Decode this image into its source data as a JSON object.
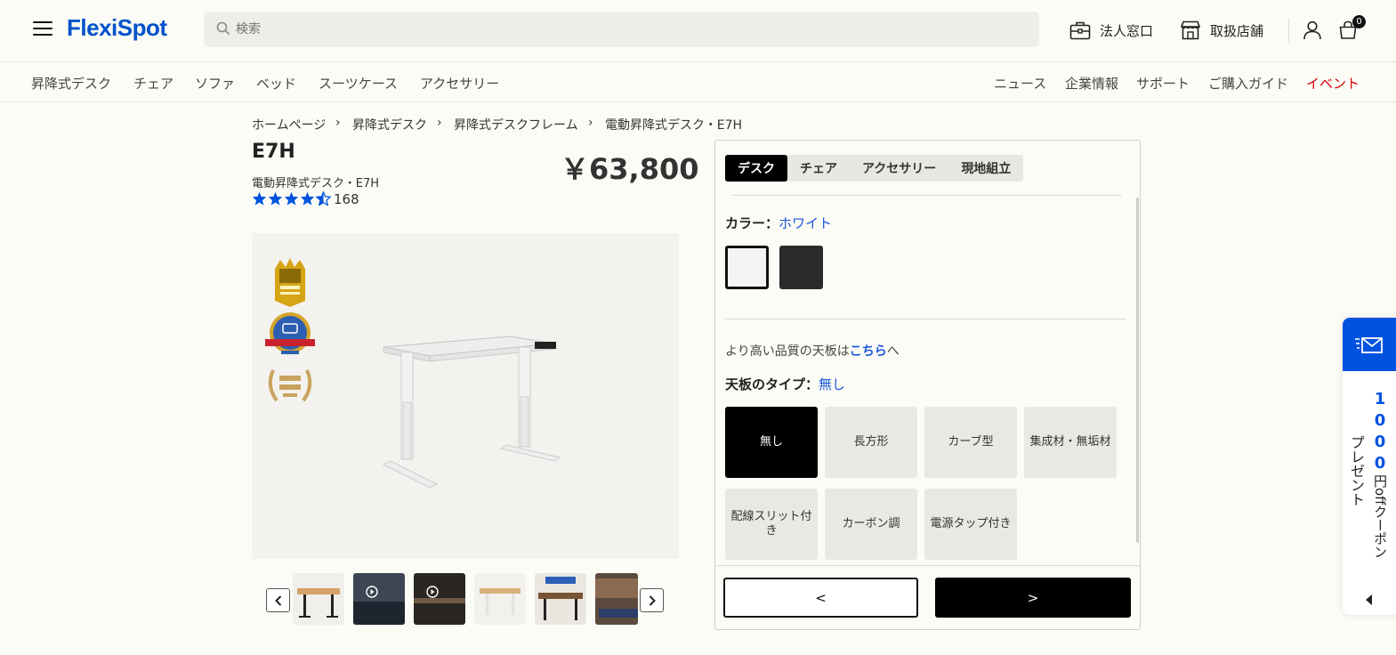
{
  "header": {
    "logo": "FlexiSpot",
    "search_placeholder": "検索",
    "business_label": "法人窓口",
    "stores_label": "取扱店舗",
    "cart_count": "0"
  },
  "nav": {
    "left": [
      "昇降式デスク",
      "チェア",
      "ソファ",
      "ベッド",
      "スーツケース",
      "アクセサリー"
    ],
    "right": [
      "ニュース",
      "企業情報",
      "サポート",
      "ご購入ガイド",
      "イベント"
    ]
  },
  "breadcrumb": [
    "ホームページ",
    "昇降式デスク",
    "昇降式デスクフレーム",
    "電動昇降式デスク・E7H"
  ],
  "product": {
    "title": "E7H",
    "subtitle": "電動昇降式デスク・E7H",
    "rating": 4.5,
    "review_count": "168",
    "price": "￥63,800"
  },
  "config": {
    "tabs": [
      "デスク",
      "チェア",
      "アクセサリー",
      "現地組立"
    ],
    "active_tab": "デスク",
    "color_label": "カラー：",
    "color_value": "ホワイト",
    "swatches": [
      "#f4f4f4",
      "#2a2a2a"
    ],
    "note_prefix": "より高い品質の天板は",
    "note_link": "こちら",
    "note_suffix": "へ",
    "top_label": "天板のタイプ：",
    "top_value": "無し",
    "top_options": [
      "無し",
      "長方形",
      "カーブ型",
      "集成材・無垢材",
      "配線スリット付き",
      "カーボン調",
      "電源タップ付き"
    ],
    "prev_label": "<",
    "next_label": ">"
  },
  "coupon": {
    "amount": "1000",
    "unit": "円off",
    "text": "クーポン",
    "text2": "プレゼント"
  },
  "colors": {
    "brand": "#0052cc",
    "event": "#d00000",
    "link": "#1a56db"
  }
}
